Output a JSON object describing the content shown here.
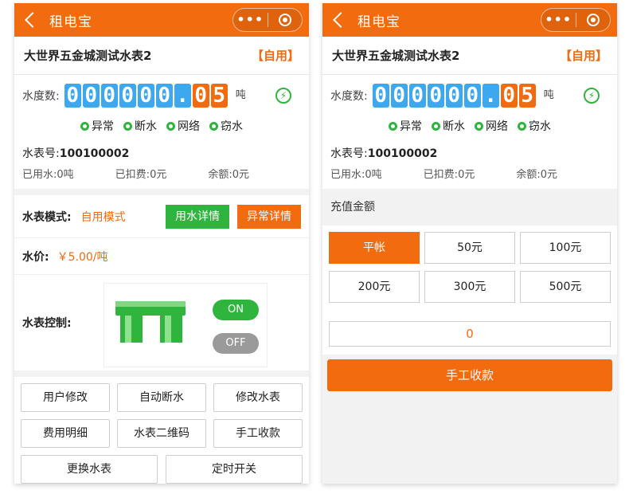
{
  "app": {
    "title": "租电宝",
    "more_glyph": "•••"
  },
  "meter": {
    "name": "大世界五金城测试水表2",
    "tag": "【自用】",
    "reading_label": "水度数:",
    "digits": [
      "0",
      "0",
      "0",
      "0",
      "0",
      "0",
      ".",
      "0",
      "5"
    ],
    "unit": "吨",
    "status": [
      "异常",
      "断水",
      "网络",
      "窃水"
    ],
    "number_label": "水表号:",
    "number": "100100002",
    "used_label": "已用水:",
    "used": "0吨",
    "deducted_label": "已扣费:",
    "deducted": "0元",
    "balance_label": "余额:",
    "balance": "0元"
  },
  "mode": {
    "label": "水表模式:",
    "value": "自用模式",
    "btn_usage": "用水详情",
    "btn_abnormal": "异常详情"
  },
  "price": {
    "label": "水价:",
    "value": "￥5.00/吨"
  },
  "control": {
    "label": "水表控制:",
    "on": "ON",
    "off": "OFF"
  },
  "actions": {
    "row1": [
      "用户修改",
      "自动断水",
      "修改水表"
    ],
    "row2": [
      "费用明细",
      "水表二维码",
      "手工收款"
    ],
    "row3": [
      "更换水表",
      "定时开关"
    ]
  },
  "recharge": {
    "label": "充值金额",
    "row1": [
      "平帐",
      "50元",
      "100元"
    ],
    "row2": [
      "200元",
      "300元",
      "500元"
    ],
    "input_value": "0",
    "submit": "手工收款"
  },
  "colors": {
    "brand": "#f26b0f",
    "green": "#2fb53e",
    "digit_blue": "#3ea8ee"
  }
}
